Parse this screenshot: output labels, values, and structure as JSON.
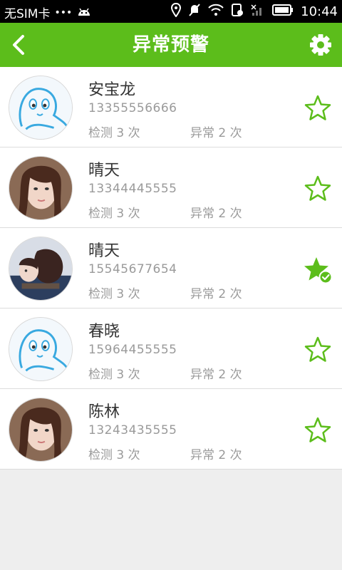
{
  "status_bar": {
    "carrier": "无SIM卡",
    "dots": "•••",
    "time": "10:44"
  },
  "header": {
    "title": "异常预警",
    "back_icon": "chevron-left-icon",
    "settings_icon": "gear-icon"
  },
  "colors": {
    "accent": "#5cbd1b",
    "text_primary": "#333333",
    "text_secondary": "#9a9a9a"
  },
  "contacts": [
    {
      "name": "安宝龙",
      "phone": "13355556666",
      "detect": "检测 3 次",
      "abnormal": "异常 2 次",
      "favorited": false,
      "avatar": "cartoon-avatar"
    },
    {
      "name": "晴天",
      "phone": "13344445555",
      "detect": "检测 3 次",
      "abnormal": "异常 2 次",
      "favorited": false,
      "avatar": "photo-avatar"
    },
    {
      "name": "晴天",
      "phone": "15545677654",
      "detect": "检测 3 次",
      "abnormal": "异常 2 次",
      "favorited": true,
      "avatar": "photo-avatar-2"
    },
    {
      "name": "春晓",
      "phone": "15964455555",
      "detect": "检测 3 次",
      "abnormal": "异常 2 次",
      "favorited": false,
      "avatar": "cartoon-avatar"
    },
    {
      "name": "陈林",
      "phone": "13243435555",
      "detect": "检测 3 次",
      "abnormal": "异常 2 次",
      "favorited": false,
      "avatar": "photo-avatar"
    }
  ]
}
